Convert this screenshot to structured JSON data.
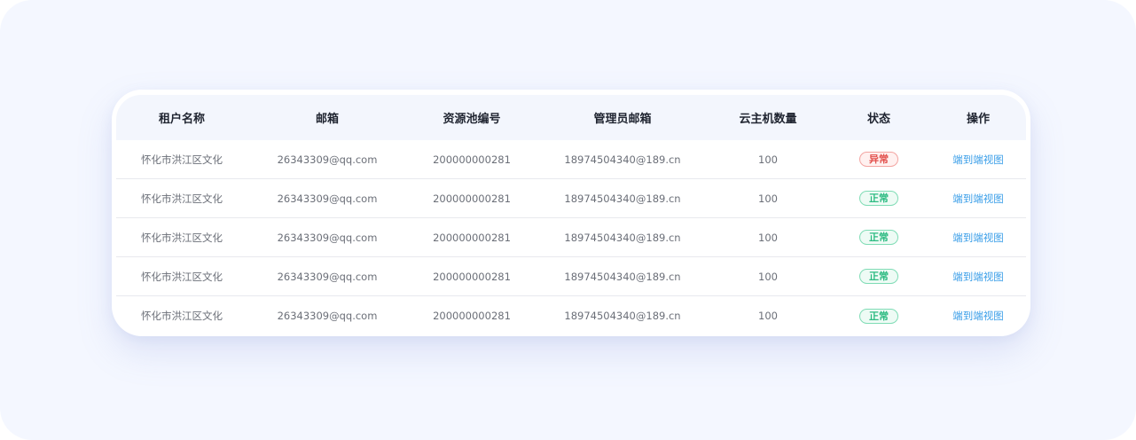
{
  "table": {
    "columns": [
      "租户名称",
      "邮箱",
      "资源池编号",
      "管理员邮箱",
      "云主机数量",
      "状态",
      "操作"
    ],
    "rows": [
      {
        "tenant": "怀化市洪江区文化",
        "email": "26343309@qq.com",
        "pool_id": "200000000281",
        "admin_email": "18974504340@189.cn",
        "vm_count": "100",
        "status": "异常",
        "status_type": "error",
        "action": "端到端视图"
      },
      {
        "tenant": "怀化市洪江区文化",
        "email": "26343309@qq.com",
        "pool_id": "200000000281",
        "admin_email": "18974504340@189.cn",
        "vm_count": "100",
        "status": "正常",
        "status_type": "normal",
        "action": "端到端视图"
      },
      {
        "tenant": "怀化市洪江区文化",
        "email": "26343309@qq.com",
        "pool_id": "200000000281",
        "admin_email": "18974504340@189.cn",
        "vm_count": "100",
        "status": "正常",
        "status_type": "normal",
        "action": "端到端视图"
      },
      {
        "tenant": "怀化市洪江区文化",
        "email": "26343309@qq.com",
        "pool_id": "200000000281",
        "admin_email": "18974504340@189.cn",
        "vm_count": "100",
        "status": "正常",
        "status_type": "normal",
        "action": "端到端视图"
      },
      {
        "tenant": "怀化市洪江区文化",
        "email": "26343309@qq.com",
        "pool_id": "200000000281",
        "admin_email": "18974504340@189.cn",
        "vm_count": "100",
        "status": "正常",
        "status_type": "normal",
        "action": "端到端视图"
      }
    ]
  },
  "colors": {
    "page_background": "#f4f7ff",
    "header_background": "#f3f6fd",
    "status_normal": "#2dbb82",
    "status_error": "#e2504c",
    "link": "#3a9ee8"
  }
}
